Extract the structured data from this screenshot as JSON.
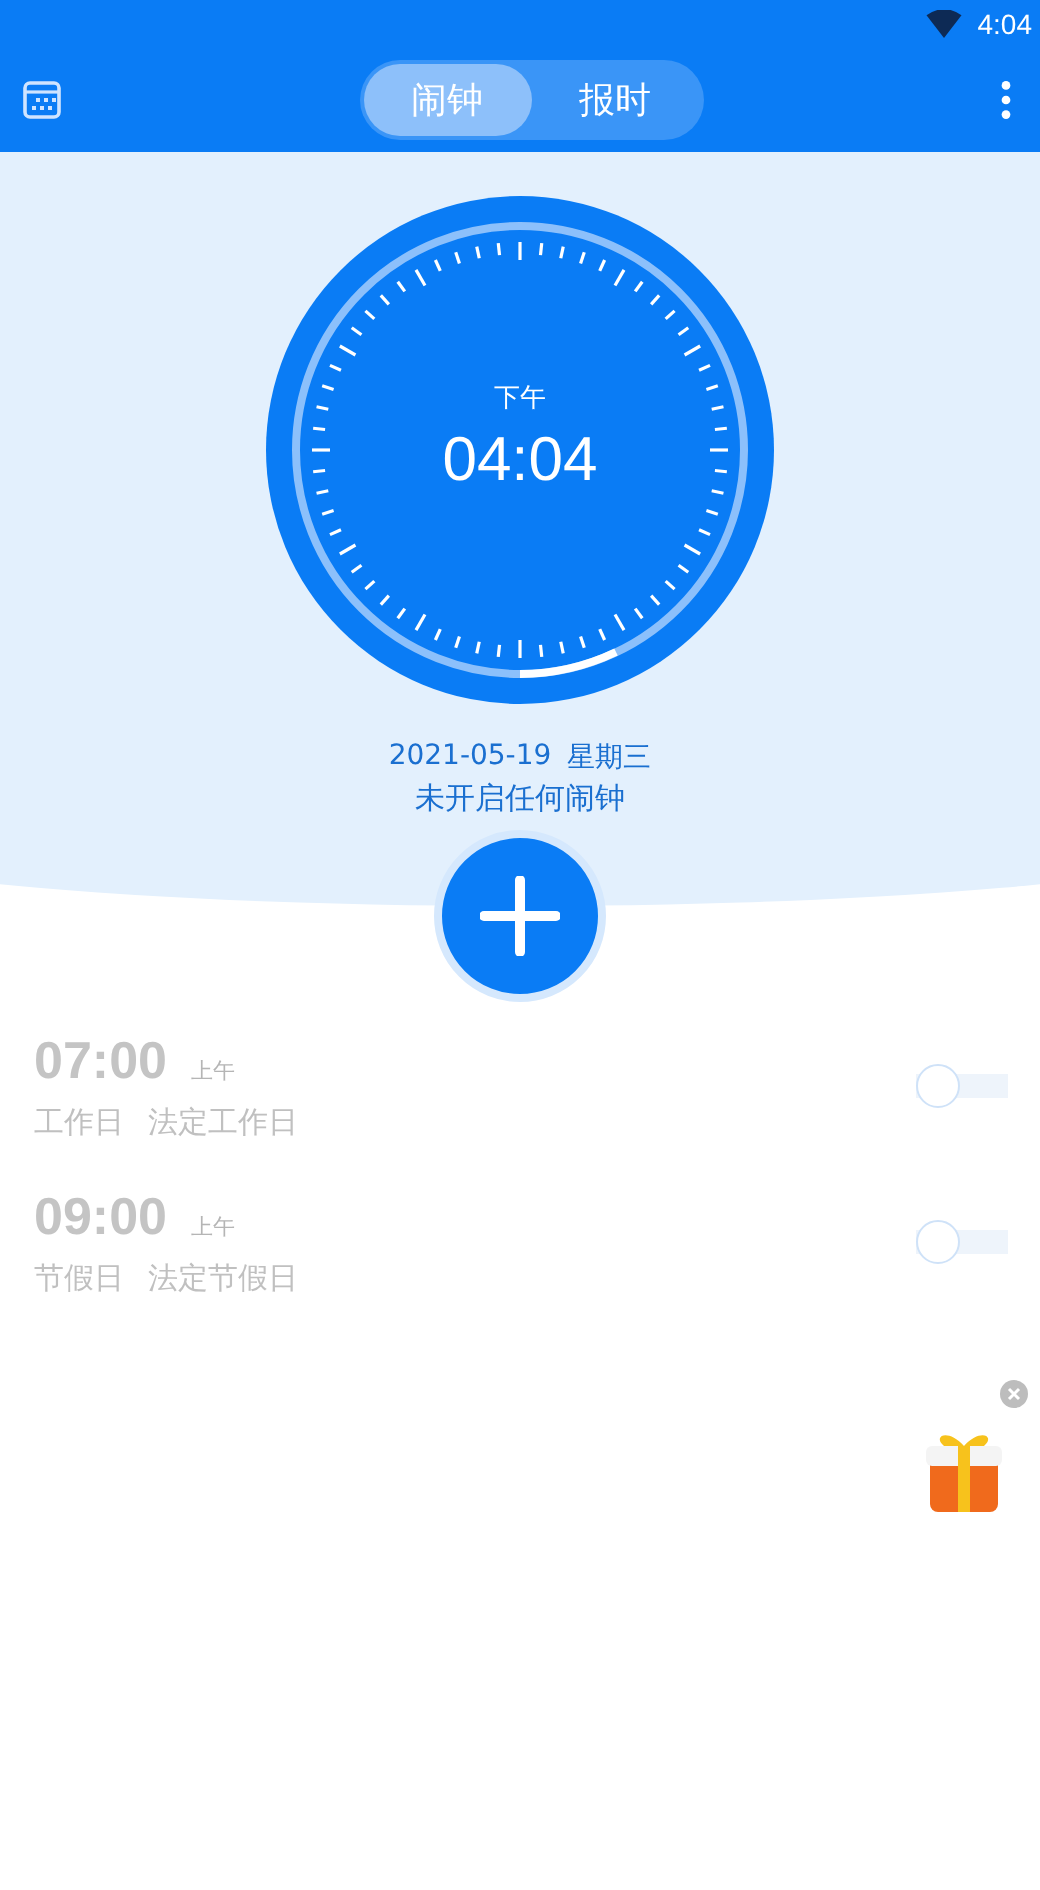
{
  "status_bar": {
    "time": "4:04"
  },
  "tabs": [
    {
      "label": "闹钟",
      "selected": true
    },
    {
      "label": "报时",
      "selected": false
    }
  ],
  "clock": {
    "period": "下午",
    "time": "04:04"
  },
  "date": {
    "date": "2021-05-19",
    "weekday": "星期三"
  },
  "status_text": "未开启任何闹钟",
  "alarms": [
    {
      "time": "07:00",
      "period": "上午",
      "days": [
        "工作日",
        "法定工作日"
      ],
      "on": false
    },
    {
      "time": "09:00",
      "period": "上午",
      "days": [
        "节假日",
        "法定节假日"
      ],
      "on": false
    }
  ],
  "floating_ad": {
    "kind": "gift"
  }
}
